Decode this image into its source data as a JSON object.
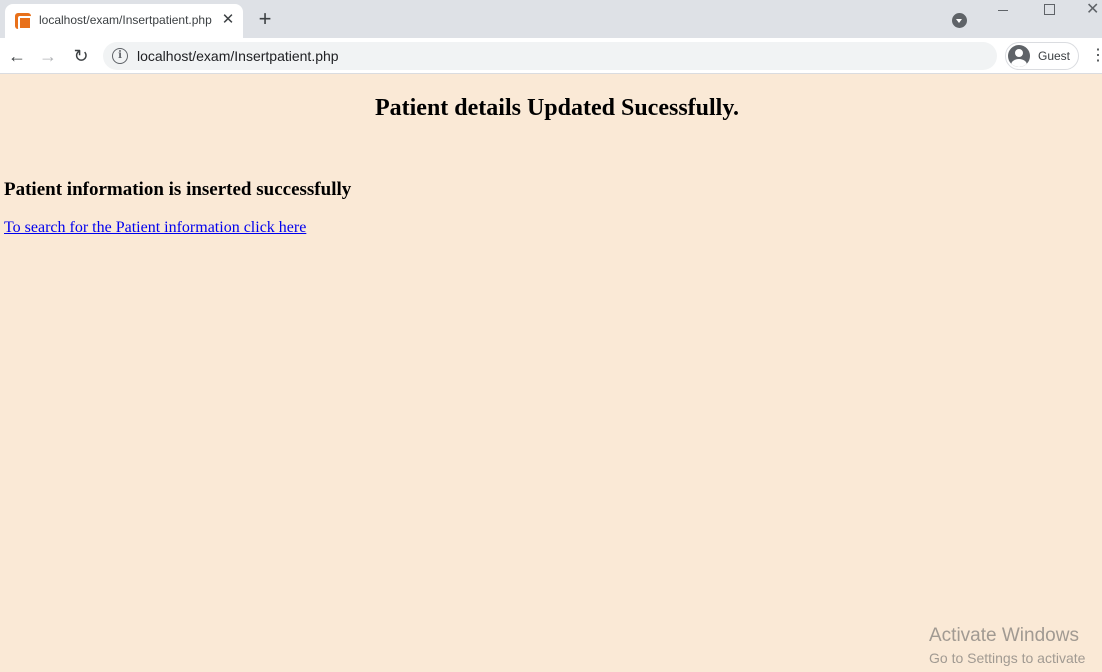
{
  "browser": {
    "tab": {
      "favicon": "xampp-icon",
      "title": "localhost/exam/Insertpatient.php",
      "close_glyph": "✕"
    },
    "new_tab_glyph": "+",
    "address_bar": {
      "url": "localhost/exam/Insertpatient.php"
    },
    "profile": {
      "label": "Guest"
    }
  },
  "page": {
    "background_color": "#fae9d6",
    "heading": "Patient details Updated Sucessfully.",
    "subheading": "Patient information is inserted successfully",
    "link_text": "To search for the Patient information click here",
    "link_color": "#0000ee"
  },
  "watermark": {
    "title": "Activate Windows",
    "subtitle": "Go to Settings to activate"
  }
}
